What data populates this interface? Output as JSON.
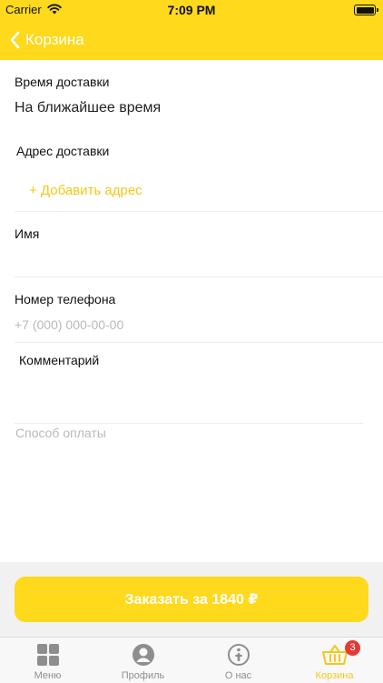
{
  "status_bar": {
    "carrier": "Carrier",
    "time": "7:09 PM"
  },
  "nav": {
    "back_label": "Корзина"
  },
  "form": {
    "delivery_time": {
      "label": "Время доставки",
      "value": "На ближайшее время"
    },
    "address": {
      "label": "Адрес доставки",
      "add_label": "+ Добавить адрес"
    },
    "name": {
      "label": "Имя",
      "value": ""
    },
    "phone": {
      "label": "Номер телефона",
      "placeholder": "+7 (000) 000-00-00"
    },
    "comment": {
      "label": "Комментарий",
      "value": ""
    },
    "payment": {
      "label": "Способ оплаты"
    }
  },
  "order_button": {
    "label": "Заказать за 1840 ₽"
  },
  "tabbar": {
    "items": [
      {
        "label": "Меню",
        "icon": "grid-icon",
        "active": false
      },
      {
        "label": "Профиль",
        "icon": "profile-icon",
        "active": false
      },
      {
        "label": "О нас",
        "icon": "info-icon",
        "active": false
      },
      {
        "label": "Корзина",
        "icon": "basket-icon",
        "active": true,
        "badge": "3"
      }
    ]
  },
  "colors": {
    "accent": "#FFD91C",
    "accent_text": "#F4C81A",
    "badge": "#E53935"
  }
}
